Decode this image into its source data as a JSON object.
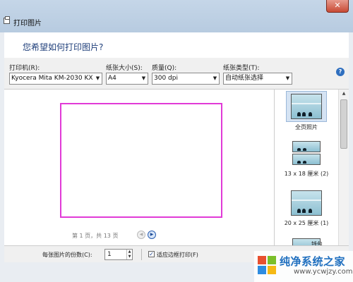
{
  "window": {
    "title": "打印图片",
    "close_symbol": "✕"
  },
  "header": {
    "question": "您希望如何打印图片?"
  },
  "options": {
    "printer": {
      "label": "打印机(R):",
      "value": "Kyocera Mita KM-2030 KX"
    },
    "paper_size": {
      "label": "纸张大小(S):",
      "value": "A4"
    },
    "quality": {
      "label": "质量(Q):",
      "value": "300 dpi"
    },
    "paper_type": {
      "label": "纸张类型(T):",
      "value": "自动纸张选择"
    },
    "help_symbol": "?"
  },
  "preview": {
    "page_info": "第 1 页，共 13 页",
    "prev_symbol": "◀",
    "next_symbol": "▶"
  },
  "layouts": [
    {
      "label": "全页照片",
      "selected": true
    },
    {
      "label": "13 x 18 厘米 (2)",
      "selected": false
    },
    {
      "label": "20 x 25 厘米 (1)",
      "selected": false
    },
    {
      "label": "钱包",
      "selected": false
    }
  ],
  "bottom": {
    "copies_label": "每张图片的份数(C):",
    "copies_value": "1",
    "fit_label": "适应边框打印(F)",
    "fit_checked": true
  },
  "watermark": {
    "brand": "纯净系统之家",
    "url": "www.ycwjzy.com"
  },
  "colors": {
    "accent": "#1e3e7a",
    "preview_border": "#e13ad7",
    "selected_bg": "#d5e3f3"
  }
}
